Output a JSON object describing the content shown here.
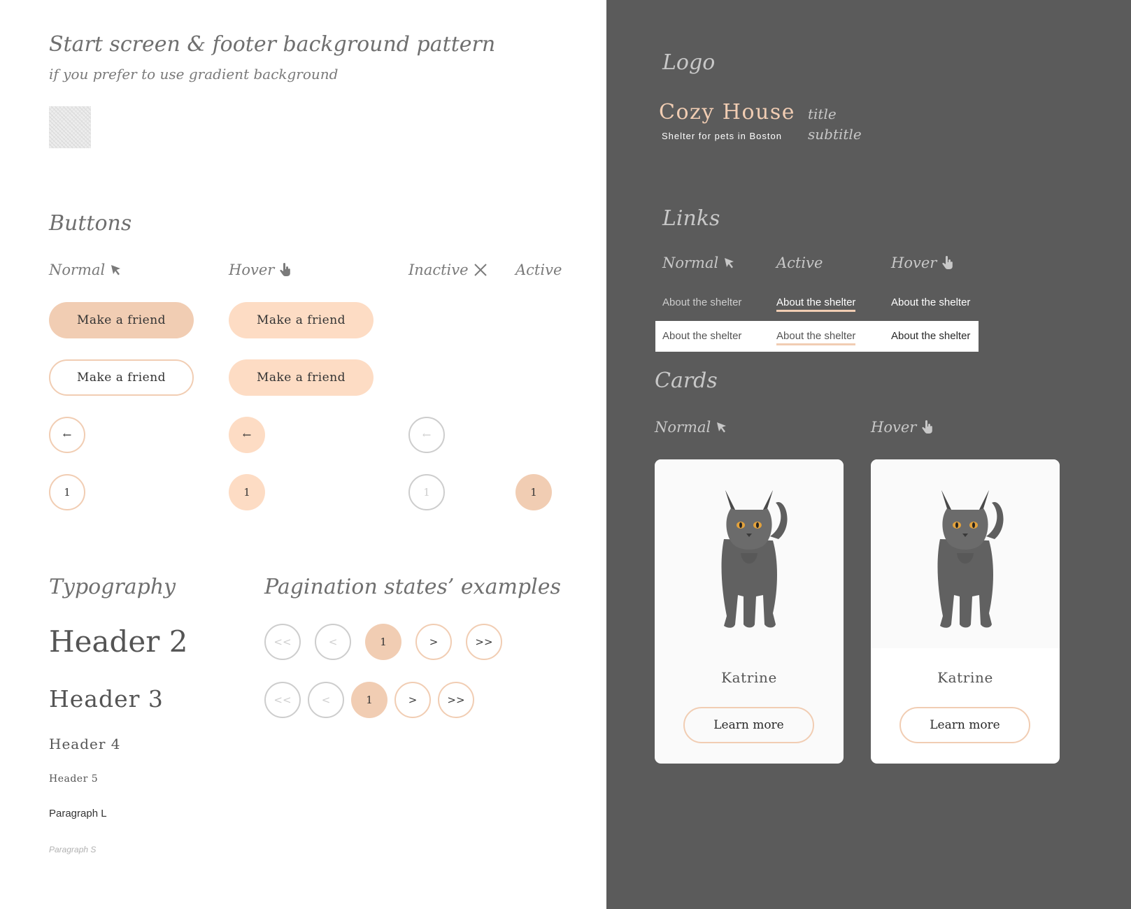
{
  "pattern_section": {
    "title": "Start screen & footer background pattern",
    "subtitle": "if you prefer to use gradient background"
  },
  "buttons_section": {
    "title": "Buttons",
    "states": {
      "normal": "Normal",
      "hover": "Hover",
      "inactive": "Inactive",
      "active": "Active"
    },
    "primary_label": "Make a friend",
    "arrow_glyph": "←",
    "page_number": "1"
  },
  "typography_section": {
    "title": "Typography",
    "h2": "Header 2",
    "h3": "Header 3",
    "h4": "Header 4",
    "h5": "Header 5",
    "p_l": "Paragraph L",
    "p_s": "Paragraph S"
  },
  "pagination_section": {
    "title": "Pagination states’ examples",
    "first": "<<",
    "prev": "<",
    "current": "1",
    "next": ">",
    "last": ">>"
  },
  "logo_section": {
    "title": "Logo",
    "logo_title": "Cozy House",
    "logo_subtitle": "Shelter for pets in Boston",
    "annotation_title": "title",
    "annotation_subtitle": "subtitle"
  },
  "links_section": {
    "title": "Links",
    "states": {
      "normal": "Normal",
      "active": "Active",
      "hover": "Hover"
    },
    "link_text": "About the shelter"
  },
  "cards_section": {
    "title": "Cards",
    "states": {
      "normal": "Normal",
      "hover": "Hover"
    },
    "pet_name": "Katrine",
    "button_label": "Learn more"
  },
  "colors": {
    "accent": "#f1cdb3",
    "accent_light": "#fddcc4",
    "dark_panel": "#5b5b5b",
    "text_dark": "#545454"
  }
}
